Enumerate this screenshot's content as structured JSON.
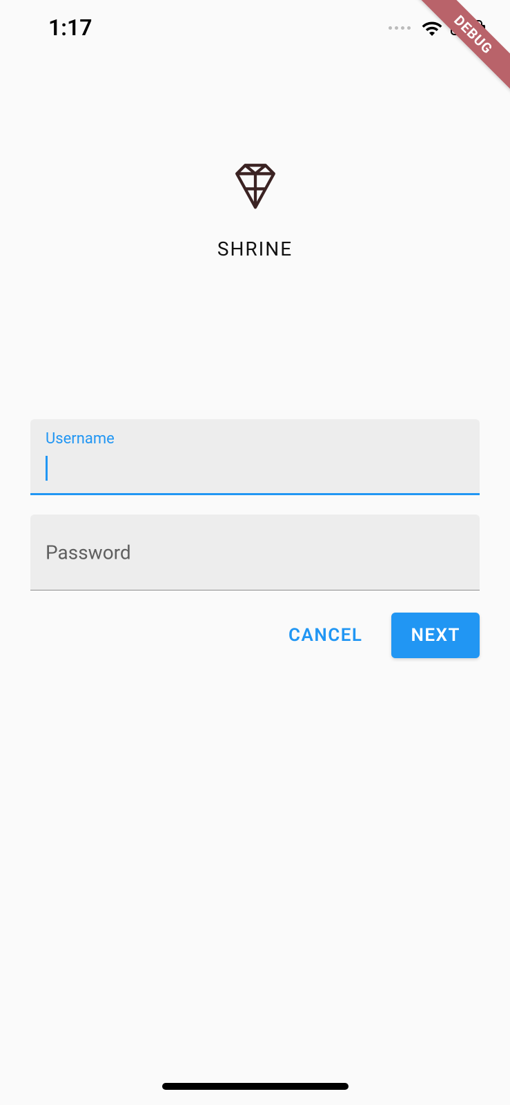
{
  "statusbar": {
    "time": "1:17"
  },
  "debug_banner": "DEBUG",
  "logo": {
    "app_name": "SHRINE"
  },
  "form": {
    "username": {
      "label": "Username",
      "value": ""
    },
    "password": {
      "label": "Password",
      "value": ""
    }
  },
  "buttons": {
    "cancel": "CANCEL",
    "next": "NEXT"
  }
}
